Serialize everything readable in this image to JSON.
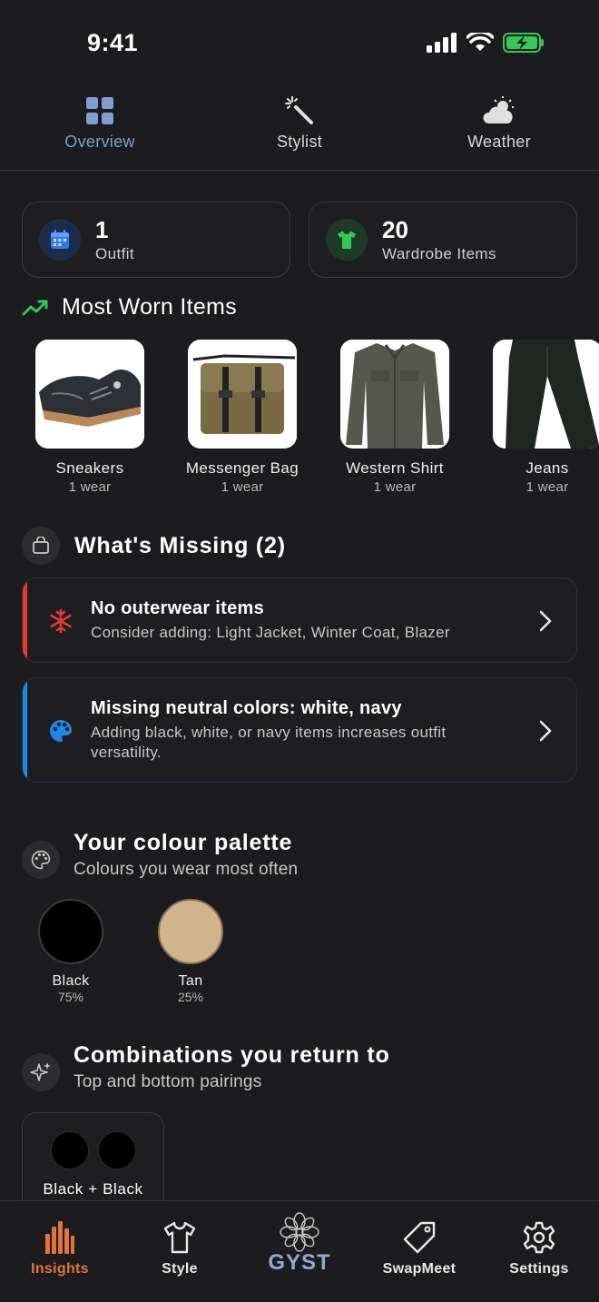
{
  "status_bar": {
    "time": "9:41"
  },
  "top_tabs": [
    {
      "label": "Overview",
      "icon": "grid-icon",
      "active": true
    },
    {
      "label": "Stylist",
      "icon": "magic-wand-icon",
      "active": false
    },
    {
      "label": "Weather",
      "icon": "partly-cloudy-icon",
      "active": false
    }
  ],
  "stats": {
    "outfits": {
      "value": "1",
      "label": "Outfit",
      "icon": "calendar-icon"
    },
    "wardrobe": {
      "value": "20",
      "label": "Wardrobe Items",
      "icon": "tshirt-icon"
    }
  },
  "most_worn": {
    "title": "Most Worn Items",
    "icon": "trending-up-icon",
    "items": [
      {
        "name": "Sneakers",
        "count": "1 wear"
      },
      {
        "name": "Messenger Bag",
        "count": "1 wear"
      },
      {
        "name": "Western Shirt",
        "count": "1 wear"
      },
      {
        "name": "Jeans",
        "count": "1 wear"
      }
    ]
  },
  "missing": {
    "title": "What's Missing (2)",
    "icon": "shopping-bag-icon",
    "items": [
      {
        "title": "No outerwear items",
        "desc": "Consider adding: Light Jacket, Winter Coat, Blazer",
        "icon": "snowflake-icon",
        "accent": "#e53935"
      },
      {
        "title": "Missing neutral colors: white, navy",
        "desc": "Adding black, white, or navy items increases outfit versatility.",
        "icon": "palette-icon",
        "accent": "#1e88e5"
      }
    ]
  },
  "palette": {
    "title": "Your colour palette",
    "subtitle": "Colours you wear most often",
    "icon": "palette-icon",
    "swatches": [
      {
        "name": "Black",
        "pct": "75%",
        "color": "#000000"
      },
      {
        "name": "Tan",
        "pct": "25%",
        "color": "#d2b48c"
      }
    ]
  },
  "combinations": {
    "title": "Combinations you return to",
    "subtitle": "Top and bottom pairings",
    "icon": "sparkles-icon",
    "items": [
      {
        "label": "Black + Black"
      }
    ]
  },
  "bottom_nav": [
    {
      "label": "Insights",
      "icon": "bar-chart-icon",
      "active": true
    },
    {
      "label": "Style",
      "icon": "tshirt-icon",
      "active": false
    },
    {
      "label": "GYST",
      "icon": "flower-logo-icon",
      "active": false
    },
    {
      "label": "SwapMeet",
      "icon": "tag-icon",
      "active": false
    },
    {
      "label": "Settings",
      "icon": "gear-icon",
      "active": false
    }
  ],
  "colors": {
    "accent_blue": "#7f9fd0",
    "accent_orange": "#e0743c",
    "green": "#34c759"
  }
}
